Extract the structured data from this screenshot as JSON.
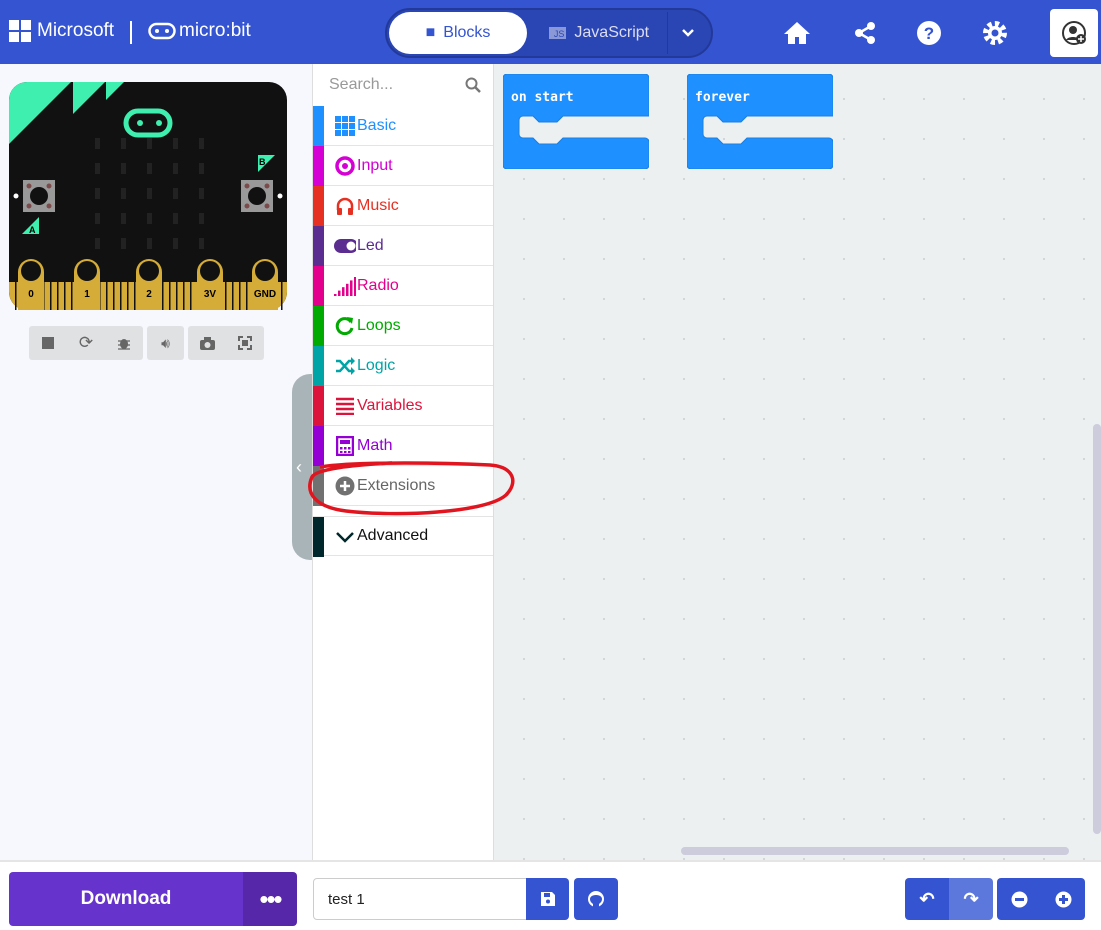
{
  "header": {
    "brand": "Microsoft",
    "product": "micro:bit",
    "tabs": [
      {
        "label": "Blocks",
        "active": true
      },
      {
        "label": "JavaScript",
        "active": false
      }
    ],
    "icons": [
      "home-icon",
      "share-icon",
      "help-icon",
      "gear-icon",
      "user-icon"
    ]
  },
  "simulator": {
    "pins": [
      "0",
      "1",
      "2",
      "3V",
      "GND"
    ],
    "buttons": [
      "A",
      "B"
    ],
    "controls": [
      "stop-icon",
      "restart-icon",
      "debug-icon",
      "sound-icon",
      "screenshot-icon",
      "fullscreen-icon"
    ]
  },
  "toolbox": {
    "search_placeholder": "Search...",
    "categories": [
      {
        "label": "Basic",
        "color": "#1E90FF"
      },
      {
        "label": "Input",
        "color": "#D400D4"
      },
      {
        "label": "Music",
        "color": "#E63022"
      },
      {
        "label": "Led",
        "color": "#5C2D91"
      },
      {
        "label": "Radio",
        "color": "#E3008C"
      },
      {
        "label": "Loops",
        "color": "#00AA00"
      },
      {
        "label": "Logic",
        "color": "#00A4A6"
      },
      {
        "label": "Variables",
        "color": "#DC143C"
      },
      {
        "label": "Math",
        "color": "#9400D3"
      },
      {
        "label": "Extensions",
        "color": "#717171"
      },
      {
        "label": "Advanced",
        "color": "#00272B"
      }
    ]
  },
  "workspace": {
    "blocks": [
      {
        "label": "on start"
      },
      {
        "label": "forever"
      }
    ],
    "block_color": "#1E90FF"
  },
  "annotation": {
    "color": "#E0151F",
    "target": "Extensions"
  },
  "footer": {
    "download_label": "Download",
    "more_label": "•••",
    "project_name": "test 1"
  }
}
